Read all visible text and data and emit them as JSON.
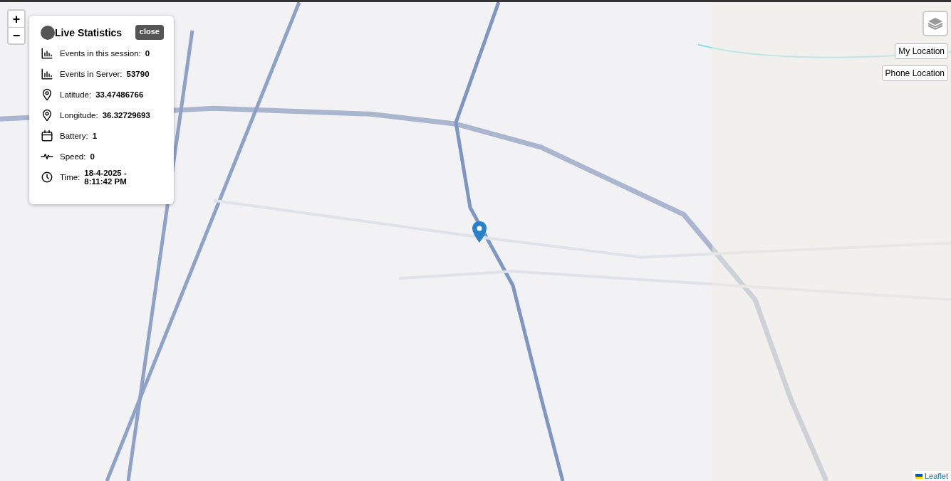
{
  "zoom_controls": [
    "+",
    "−"
  ],
  "panel": {
    "title": "Live Statistics",
    "close": "close",
    "rows": [
      {
        "kind": "chart",
        "label": "Events in this session:",
        "value": "0"
      },
      {
        "kind": "chart",
        "label": "Events in Server:",
        "value": "53790"
      },
      {
        "kind": "pin",
        "label": "Latitude:",
        "value": "33.47486766"
      },
      {
        "kind": "pin",
        "label": "Longitude:",
        "value": "36.32729693"
      },
      {
        "kind": "calendar",
        "label": "Battery:",
        "value": "1"
      },
      {
        "kind": "pulse",
        "label": "Speed:",
        "value": "0"
      },
      {
        "kind": "clock",
        "label": "Time:",
        "value": "18-4-2025 - 8:11:42 PM"
      }
    ]
  },
  "buttons": [
    "My Location",
    "Phone Location"
  ],
  "attribution": "Leaflet"
}
